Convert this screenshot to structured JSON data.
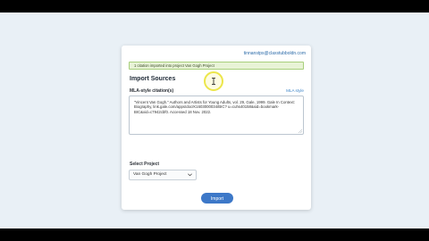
{
  "header": {
    "user_email": "tinnanstps@claxstubboldn.com"
  },
  "alert": {
    "message": "1 citation imported into project Van Gogh Project"
  },
  "section": {
    "title": "Import Sources"
  },
  "citation_field": {
    "label": "MLA-style citation(s)",
    "help_link": "MLA style",
    "value": "\"Vincent Van Gogh.\" Authors and Artists for Young Adults, vol. 29, Gale, 1999. Gale In Context: Biography, link.gale.com/apps/doc/K1603000034/BIC? u=cuhs40158&sid=bookmark-BIC&xid=c7942cbf0. Accessed 18 Nov. 2022."
  },
  "project_select": {
    "label": "Select Project",
    "selected": "Van Gogh Project"
  },
  "import_button": {
    "label": "Import"
  },
  "colors": {
    "primary": "#3d78c8",
    "alert_bg": "#e8f3d6",
    "alert_border": "#a8cf7c",
    "page_bg": "#e9f0f6"
  },
  "icons": {
    "select_chevron": "chevron-down-icon",
    "cursor": "text-cursor-icon"
  }
}
